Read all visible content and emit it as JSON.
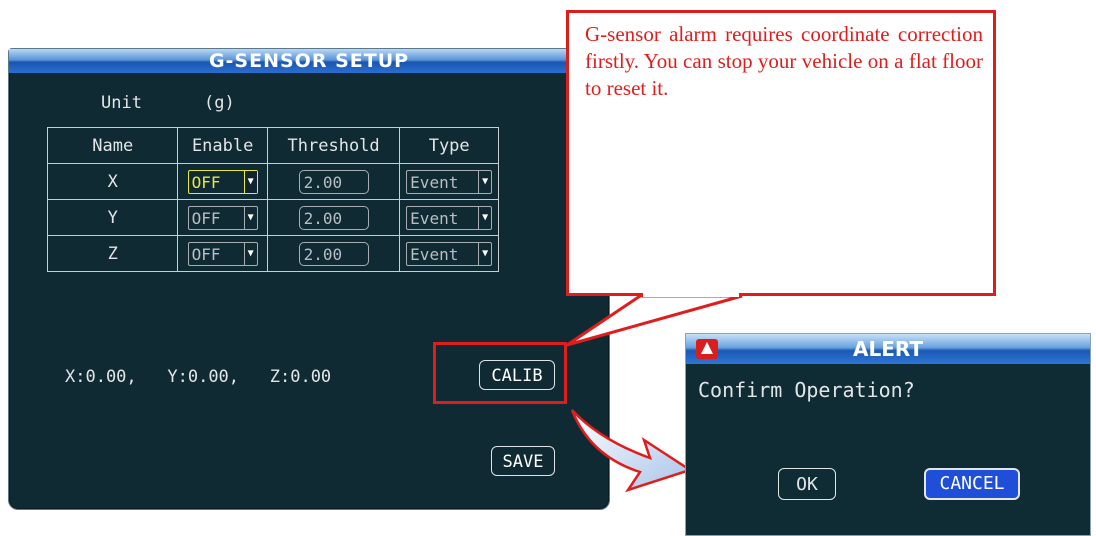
{
  "gsensor": {
    "title": "G-SENSOR SETUP",
    "unit_label": "Unit",
    "unit_value": "(g)",
    "headers": [
      "Name",
      "Enable",
      "Threshold",
      "Type"
    ],
    "rows": [
      {
        "name": "X",
        "enable": "OFF",
        "threshold": "2.00",
        "type": "Event",
        "selected": true
      },
      {
        "name": "Y",
        "enable": "OFF",
        "threshold": "2.00",
        "type": "Event",
        "selected": false
      },
      {
        "name": "Z",
        "enable": "OFF",
        "threshold": "2.00",
        "type": "Event",
        "selected": false
      }
    ],
    "coords": {
      "x": "X:0.00,",
      "y": "Y:0.00,",
      "z": "Z:0.00"
    },
    "calib_label": "CALIB",
    "save_label": "SAVE"
  },
  "callout": {
    "text": "G-sensor alarm requires coordinate correction firstly. You can stop your vehicle on a flat floor to reset it."
  },
  "alert": {
    "title": "ALERT",
    "message": "Confirm Operation?",
    "ok_label": "OK",
    "cancel_label": "CANCEL"
  },
  "colors": {
    "panel_bg": "#102a33",
    "title_bar": "#1a56b0",
    "annotation_red": "#e01d1d",
    "selection_yellow": "#e8e83a",
    "cancel_focus": "#1f4fd8"
  },
  "icons": {
    "dropdown": "chevron-down-icon",
    "alert": "warning-icon"
  }
}
